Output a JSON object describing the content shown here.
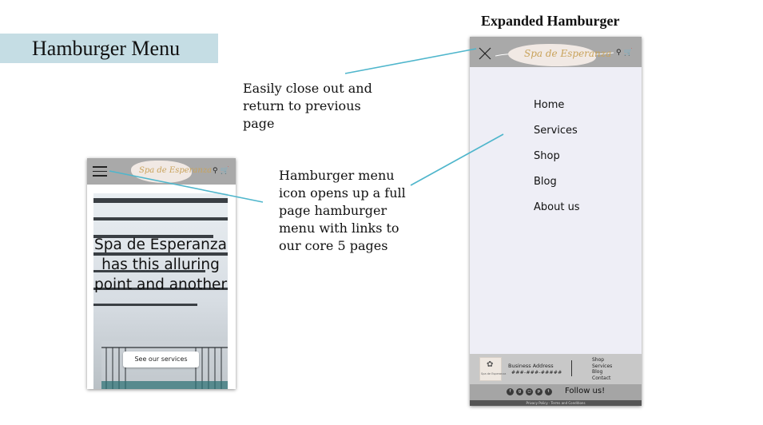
{
  "slide": {
    "title": "Hamburger Menu",
    "expanded_heading": "Expanded Hamburger",
    "annotation_close": "Easily close out and return to previous page",
    "annotation_menu": "Hamburger menu icon opens up a full page hamburger menu with links to our core 5 pages",
    "title_bg_color": "#c5dde4",
    "connector_color": "#4fb6cc"
  },
  "small_phone": {
    "logo_text": "Spa de Esperanza",
    "header_icons": "⚲ 🛒",
    "hero_text": "Spa de Esperanza has this alluring point and another",
    "cta_label": "See our services"
  },
  "expanded_menu": {
    "logo_text": "Spa de Esperanza",
    "logo_subtitle": "",
    "header_icons": "⚲ 🛒",
    "nav_items": [
      "Home",
      "Services",
      "Shop",
      "Blog",
      "About us"
    ],
    "footer": {
      "badge_text": "Spa de Esperanza",
      "business_address_label": "Business Address",
      "business_address_value": "###-###-#####",
      "links": [
        "Shop",
        "Services",
        "Blog",
        "Contact"
      ],
      "follow_label": "Follow us!",
      "legal_text": "Privacy Policy · Terms and Conditions"
    }
  }
}
